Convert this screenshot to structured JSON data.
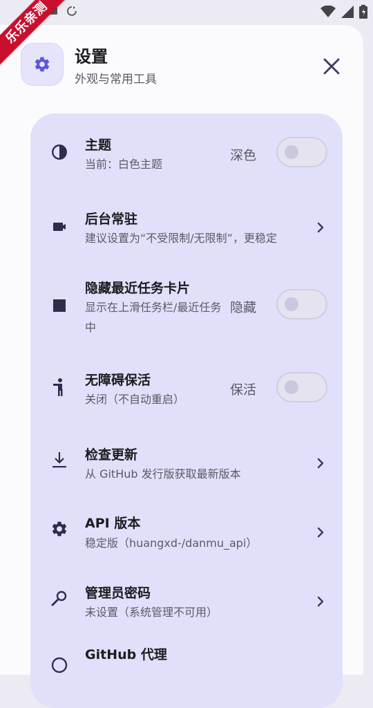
{
  "watermark": "乐乐亲测",
  "header": {
    "title": "设置",
    "subtitle": "外观与常用工具"
  },
  "settings": [
    {
      "title": "主题",
      "subtitle": "当前：白色主题",
      "value": "深色",
      "control": "toggle",
      "toggle_on": false,
      "icon": "contrast-icon"
    },
    {
      "title": "后台常驻",
      "subtitle": "建议设置为“不受限制/无限制”，更稳定",
      "control": "chevron",
      "icon": "video-camera-icon"
    },
    {
      "title": "隐藏最近任务卡片",
      "subtitle": "显示在上滑任务栏/最近任务中",
      "value": "隐藏",
      "control": "toggle",
      "toggle_on": false,
      "icon": "square-icon"
    },
    {
      "title": "无障碍保活",
      "subtitle": "关闭（不自动重启）",
      "value": "保活",
      "control": "toggle",
      "toggle_on": false,
      "icon": "accessibility-icon"
    },
    {
      "title": "检查更新",
      "subtitle": "从 GitHub 发行版获取最新版本",
      "control": "chevron",
      "icon": "download-icon"
    },
    {
      "title": "API 版本",
      "subtitle": "稳定版（huangxd-/danmu_api）",
      "control": "chevron",
      "icon": "gear-icon"
    },
    {
      "title": "管理员密码",
      "subtitle": "未设置（系统管理不可用）",
      "control": "chevron",
      "icon": "key-icon"
    },
    {
      "title": "GitHub 代理",
      "subtitle": "",
      "control": "chevron",
      "icon": "globe-icon"
    }
  ],
  "colors": {
    "accent": "#5b57d6",
    "card": "#e1e0fa",
    "sheet": "#fbfbfe",
    "ribbon": "#c8102e"
  }
}
